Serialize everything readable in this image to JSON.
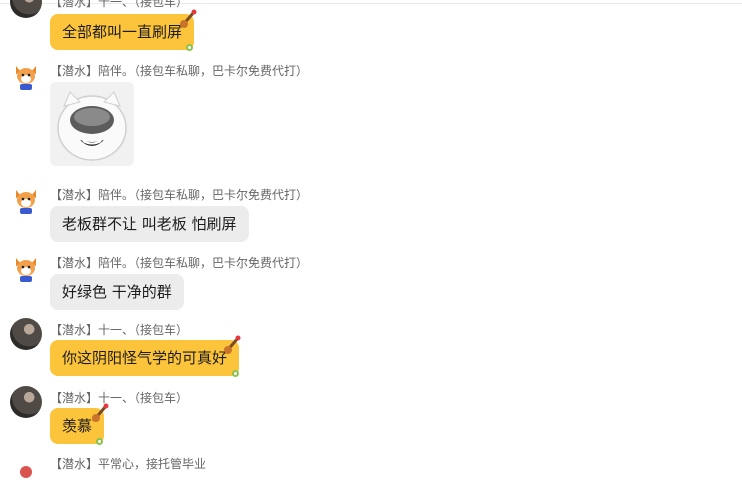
{
  "top_partial": {
    "name": "【潜水】十一、（接包车）"
  },
  "messages": [
    {
      "name": "",
      "text": "全部都叫一直刷屏"
    },
    {
      "name": "【潜水】陪伴。（接包车私聊，巴卡尔免费代打）",
      "sticker": "covering-face-cat-sticker"
    },
    {
      "name": "【潜水】陪伴。（接包车私聊，巴卡尔免费代打）",
      "text": "老板群不让 叫老板 怕刷屏"
    },
    {
      "name": "【潜水】陪伴。（接包车私聊，巴卡尔免费代打）",
      "text": "好绿色  干净的群"
    },
    {
      "name": "【潜水】十一、（接包车）",
      "text": "你这阴阳怪气学的可真好"
    },
    {
      "name": "【潜水】十一、（接包车）",
      "text": "羡慕"
    },
    {
      "name": "【潜水】平常心，接托管毕业",
      "text": ""
    }
  ],
  "colors": {
    "bubble_yellow": "#fcc43b",
    "bubble_gray": "#ececec",
    "name_text": "#666666"
  }
}
